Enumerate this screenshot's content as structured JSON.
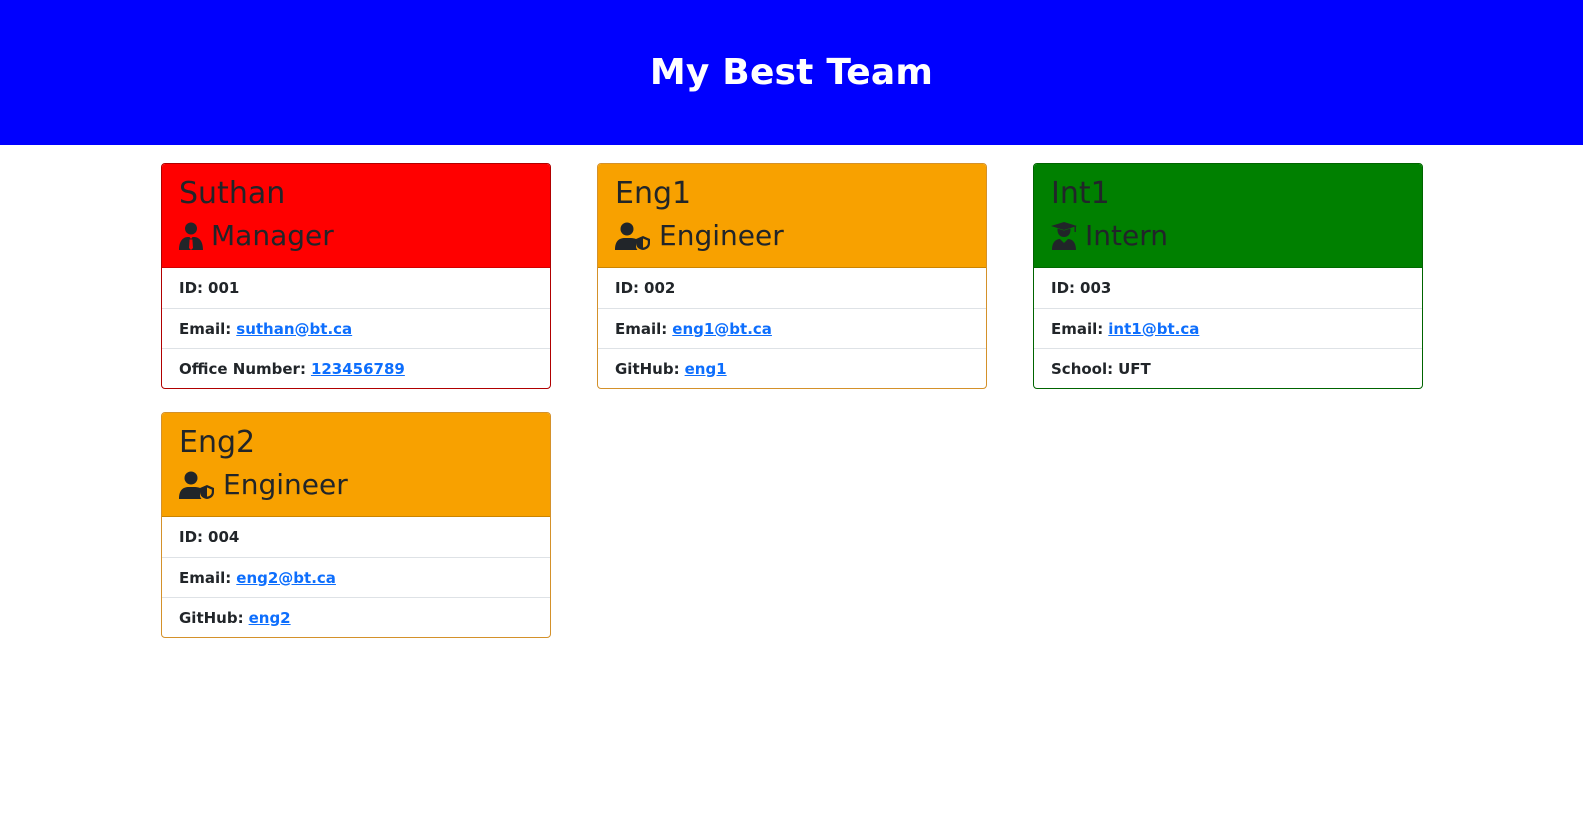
{
  "page": {
    "title": "My Best Team"
  },
  "colors": {
    "banner": "#0000ff",
    "manager": "#ff0000",
    "engineer": "#f8a100",
    "intern": "#008000",
    "link": "#0d6efd"
  },
  "cards": [
    {
      "name": "Suthan",
      "role": "Manager",
      "icon": "user-tie-icon",
      "id_label": "ID:",
      "id_value": "001",
      "email_label": "Email:",
      "email_value": "suthan@bt.ca",
      "extra_label": "Office Number:",
      "extra_value": "123456789"
    },
    {
      "name": "Eng1",
      "role": "Engineer",
      "icon": "user-shield-icon",
      "id_label": "ID:",
      "id_value": "002",
      "email_label": "Email:",
      "email_value": "eng1@bt.ca",
      "extra_label": "GitHub:",
      "extra_value": "eng1"
    },
    {
      "name": "Int1",
      "role": "Intern",
      "icon": "user-graduate-icon",
      "id_label": "ID:",
      "id_value": "003",
      "email_label": "Email:",
      "email_value": "int1@bt.ca",
      "extra_label": "School:",
      "extra_value": "UFT"
    },
    {
      "name": "Eng2",
      "role": "Engineer",
      "icon": "user-shield-icon",
      "id_label": "ID:",
      "id_value": "004",
      "email_label": "Email:",
      "email_value": "eng2@bt.ca",
      "extra_label": "GitHub:",
      "extra_value": "eng2"
    }
  ]
}
